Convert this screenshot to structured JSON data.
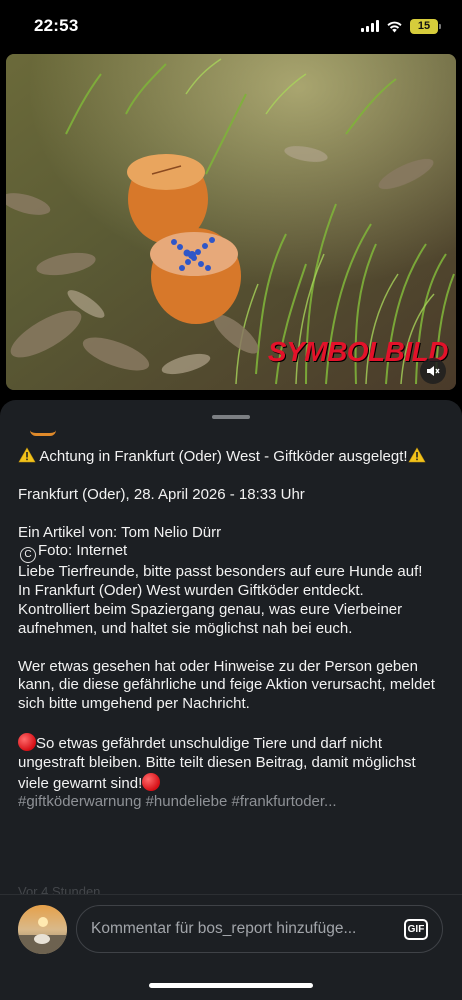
{
  "status_bar": {
    "time": "22:53",
    "battery": "15"
  },
  "media": {
    "overlay_text": "SYMBOLBILD",
    "mute_icon": "speaker-muted-icon"
  },
  "post": {
    "title_line": "Achtung in Frankfurt (Oder) West - Giftköder ausgelegt!",
    "location_date": "Frankfurt (Oder), 28. April 2026 - 18:33 Uhr",
    "author": "Ein Artikel von: Tom Nelio Dürr",
    "photo_credit": "Foto: Internet",
    "paragraph1": "Liebe Tierfreunde, bitte passt besonders auf eure Hunde auf! In Frankfurt (Oder) West wurden Giftköder entdeckt. Kontrolliert beim Spaziergang genau, was eure Vierbeiner aufnehmen, und haltet sie möglichst nah bei euch.",
    "paragraph2": "Wer etwas gesehen hat oder Hinweise zu der Person geben kann, die diese gefährliche und feige Aktion verursacht, meldet sich bitte umgehend per Nachricht.",
    "paragraph3": "So etwas gefährdet unschuldige Tiere und darf nicht ungestraft bleiben. Bitte teilt diesen Beitrag, damit möglichst viele gewarnt sind!",
    "hashtags": "#giftköderwarnung #hundeliebe #frankfurtoder...",
    "faded_line": "Vor 4 Stunden"
  },
  "comment": {
    "placeholder": "Kommentar für bos_report hinzufüge...",
    "gif_label": "GIF"
  },
  "colors": {
    "sheet_bg": "#1c1f23",
    "accent_red": "#e3122a",
    "muted_text": "#8e9196"
  }
}
